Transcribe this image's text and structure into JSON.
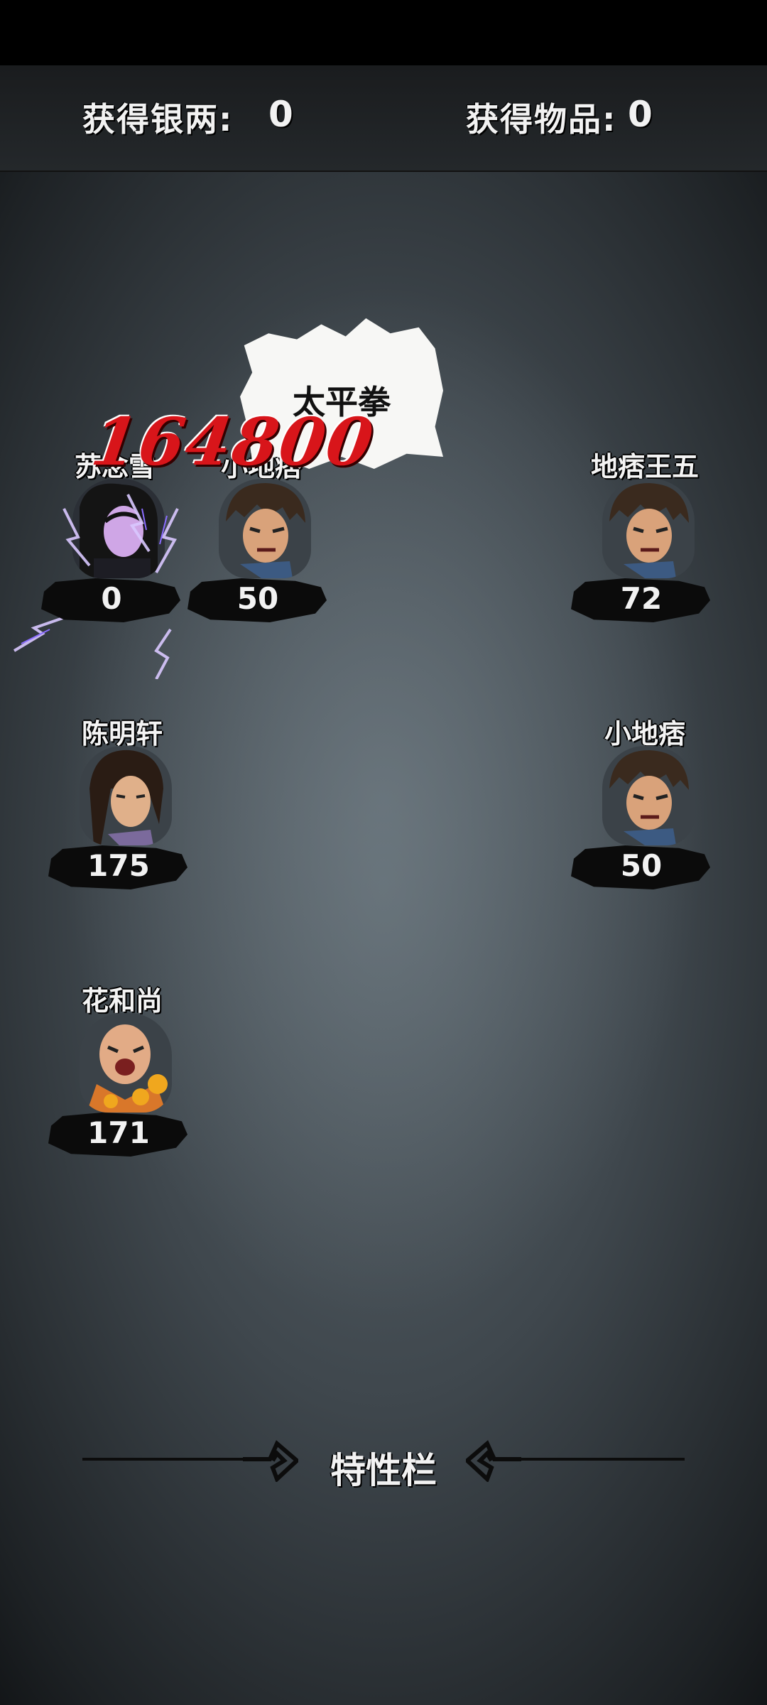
{
  "top_bar": {
    "silver_label": "获得银两:",
    "silver_value": "0",
    "items_label": "获得物品:",
    "items_value": "0"
  },
  "skill_bubble": {
    "text": "太平拳"
  },
  "damage_popup": {
    "text": "164800"
  },
  "allies": [
    {
      "name": "苏念雪",
      "hp": "0",
      "portrait": "female-swordsman-portrait"
    },
    {
      "name": "陈明轩",
      "hp": "175",
      "portrait": "swordsman-portrait"
    },
    {
      "name": "花和尚",
      "hp": "171",
      "portrait": "monk-portrait"
    }
  ],
  "enemies": [
    {
      "name": "小地痞",
      "hp": "50",
      "portrait": "thug-portrait"
    },
    {
      "name": "地痞王五",
      "hp": "72",
      "portrait": "thug-portrait"
    },
    {
      "name": "小地痞",
      "hp": "50",
      "portrait": "thug-portrait"
    }
  ],
  "traits_section": {
    "title": "特性栏"
  },
  "colors": {
    "damage": "#d8151a",
    "background": "#4a5359"
  }
}
